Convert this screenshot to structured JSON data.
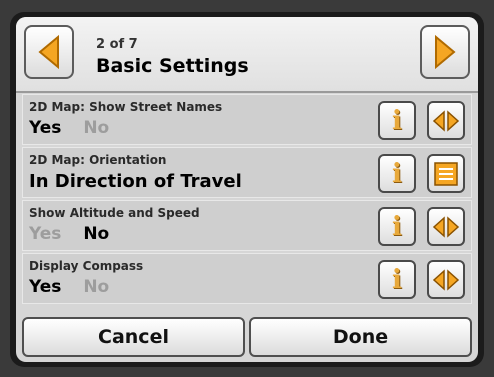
{
  "header": {
    "page_counter": "2 of 7",
    "title": "Basic Settings"
  },
  "settings": [
    {
      "label": "2D Map: Show Street Names",
      "options": [
        "Yes",
        "No"
      ],
      "selected": "Yes",
      "control_icon": "left-right-arrows-icon"
    },
    {
      "label": "2D Map: Orientation",
      "value": "In Direction of Travel",
      "control_icon": "list-icon"
    },
    {
      "label": "Show Altitude and Speed",
      "options": [
        "Yes",
        "No"
      ],
      "selected": "No",
      "control_icon": "left-right-arrows-icon"
    },
    {
      "label": "Display Compass",
      "options": [
        "Yes",
        "No"
      ],
      "selected": "Yes",
      "control_icon": "left-right-arrows-icon"
    }
  ],
  "footer": {
    "cancel_label": "Cancel",
    "done_label": "Done"
  },
  "colors": {
    "accent_orange": "#f5a623",
    "selected_text": "#000000",
    "unselected_text": "#9d9d9d"
  }
}
